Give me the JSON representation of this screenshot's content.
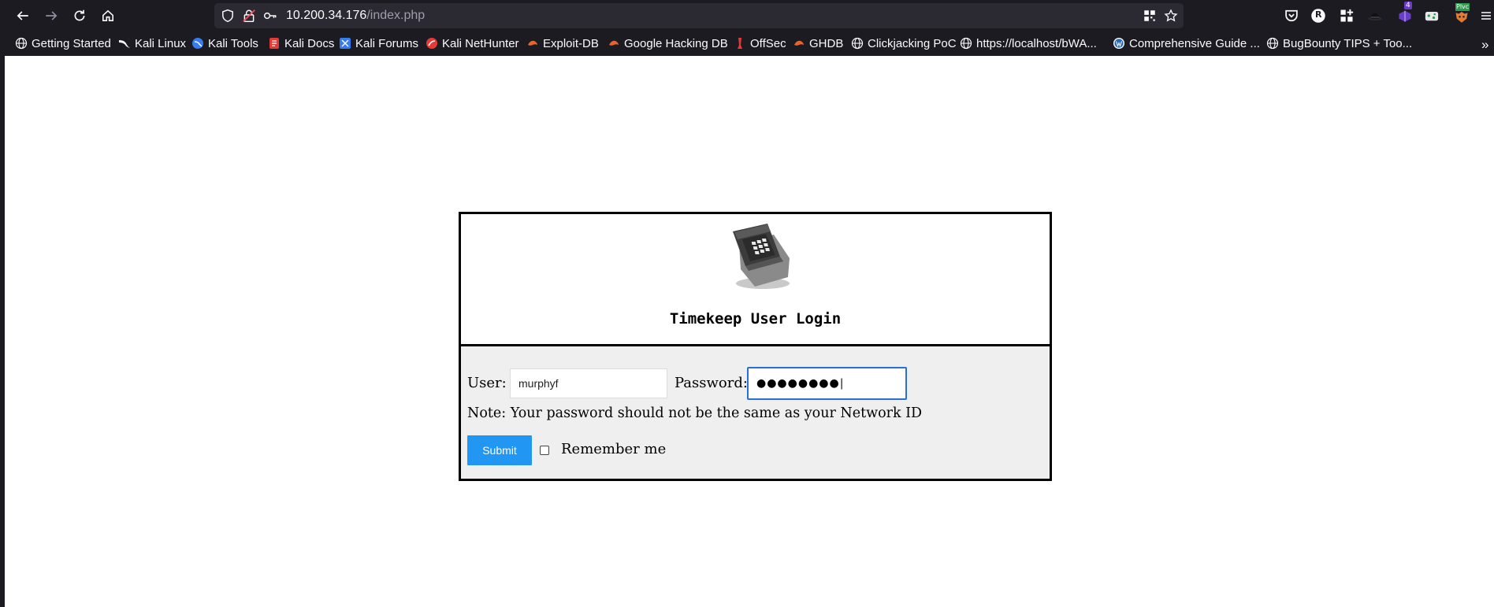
{
  "browser": {
    "url_host": "10.200.34.176",
    "url_path": "/index.php",
    "bookmarks": [
      {
        "label": "Getting Started",
        "icon": "globe-icon"
      },
      {
        "label": "Kali Linux",
        "icon": "kali-dragon-icon"
      },
      {
        "label": "Kali Tools",
        "icon": "kali-tools-icon"
      },
      {
        "label": "Kali Docs",
        "icon": "kali-docs-icon"
      },
      {
        "label": "Kali Forums",
        "icon": "kali-forums-icon"
      },
      {
        "label": "Kali NetHunter",
        "icon": "kali-nethunter-icon"
      },
      {
        "label": "Exploit-DB",
        "icon": "exploit-db-icon"
      },
      {
        "label": "Google Hacking DB",
        "icon": "exploit-db-icon"
      },
      {
        "label": "OffSec",
        "icon": "offsec-icon"
      },
      {
        "label": "GHDB",
        "icon": "exploit-db-icon"
      },
      {
        "label": "Clickjacking PoC",
        "icon": "globe-icon"
      },
      {
        "label": "https://localhost/bWA...",
        "icon": "globe-icon"
      },
      {
        "label": "Comprehensive Guide ...",
        "icon": "wordpress-icon"
      },
      {
        "label": "BugBounty TIPS + Too...",
        "icon": "globe-icon"
      }
    ],
    "overflow_label": "»",
    "extension_badge": "4",
    "extension_tag": "Plvc",
    "profile_initial": "R",
    "colors": {
      "chrome_bg": "#1c1b22",
      "urlbar_bg": "#2b2a33",
      "accent": "#2196f3"
    }
  },
  "login": {
    "title": "Timekeep User Login",
    "user_label": "User:",
    "user_value": "murphyf",
    "password_label": "Password:",
    "password_value": "●●●●●●●●|",
    "note": "Note: Your password should not be the same as your Network ID",
    "submit_label": "Submit",
    "remember_label": "Remember me"
  }
}
